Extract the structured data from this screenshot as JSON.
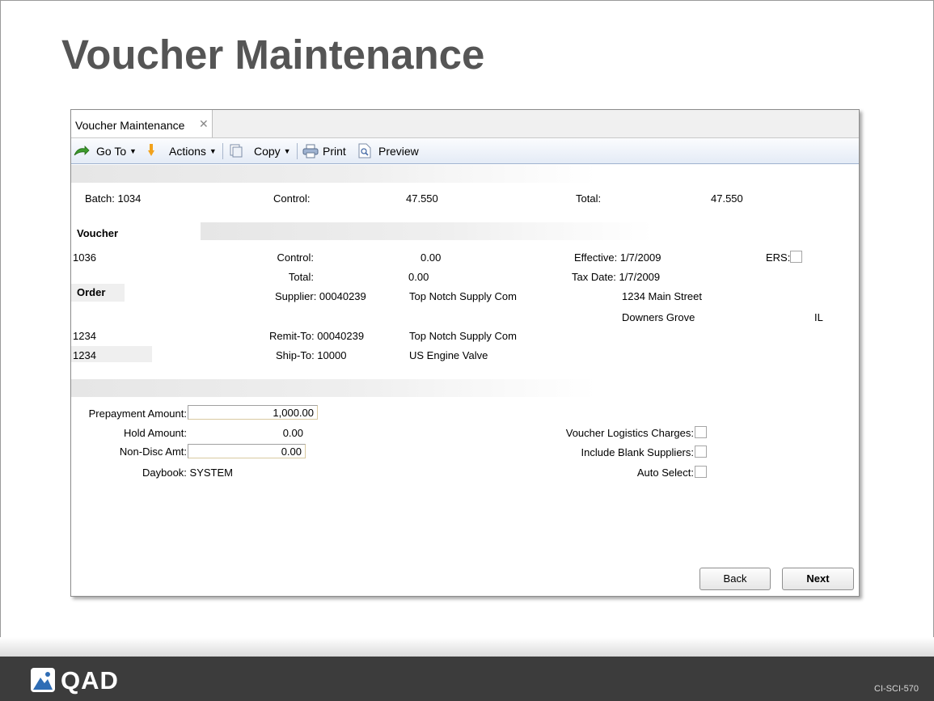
{
  "slide": {
    "title": "Voucher Maintenance",
    "doc_code": "CI-SCI-570",
    "logo_text": "QAD"
  },
  "window": {
    "tab_label": "Voucher Maintenance",
    "tab_close": "✕",
    "toolbar": {
      "goto": "Go To",
      "actions": "Actions",
      "copy": "Copy",
      "print": "Print",
      "preview": "Preview"
    }
  },
  "batch": {
    "batch_label": "Batch: 1034",
    "control_label": "Control:",
    "control_value": "47.550",
    "total_label": "Total:",
    "total_value": "47.550"
  },
  "voucher": {
    "heading": "Voucher",
    "number": "1036",
    "control_label": "Control:",
    "control_value": "0.00",
    "total_label": "Total:",
    "total_value": "0.00",
    "effective": "Effective: 1/7/2009",
    "tax_date": "Tax Date: 1/7/2009",
    "ers_label": "ERS:"
  },
  "order": {
    "heading": "Order",
    "supplier_label": "Supplier: 00040239",
    "supplier_name": "Top Notch Supply Com",
    "address_line": "1234 Main Street",
    "city": "Downers Grove",
    "state": "IL",
    "remit_ref": "1234",
    "remit_label": "Remit-To: 00040239",
    "remit_name": "Top Notch Supply Com",
    "ship_ref": "1234",
    "ship_label": "Ship-To: 10000",
    "ship_name": "US Engine Valve"
  },
  "amounts": {
    "prepayment_label": "Prepayment Amount:",
    "prepayment_value": "1,000.00",
    "hold_label": "Hold Amount:",
    "hold_value": "0.00",
    "nondisc_label": "Non-Disc Amt:",
    "nondisc_value": "0.00",
    "daybook": "Daybook: SYSTEM",
    "logistics_label": "Voucher Logistics Charges:",
    "blank_suppliers_label": "Include Blank Suppliers:",
    "auto_select_label": "Auto Select:"
  },
  "buttons": {
    "back": "Back",
    "next": "Next"
  },
  "colors": {
    "title_gray": "#555555",
    "footer_dark": "#3c3c3c",
    "toolbar_blue": "#e4ebf6",
    "goto_green": "#3c9b2c",
    "actions_orange": "#f2a21c",
    "logo_blue": "#2f6db5"
  }
}
